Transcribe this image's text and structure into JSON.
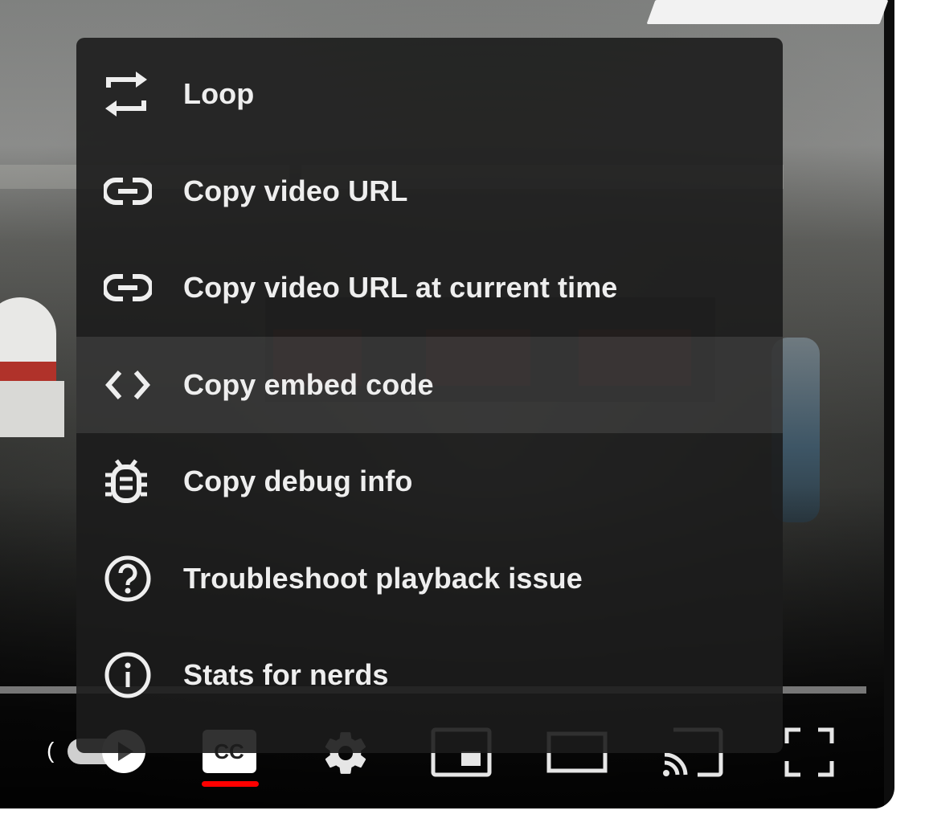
{
  "player": {
    "time_partial": "(",
    "controls": {
      "play": "play-icon",
      "subtitles": "subtitles-icon",
      "settings": "gear-icon",
      "miniplayer": "miniplayer-icon",
      "theater": "theater-mode-icon",
      "cast": "cast-icon",
      "fullscreen": "fullscreen-icon"
    },
    "cc_active_color": "#ff0000"
  },
  "context_menu": {
    "items": [
      {
        "label": "Loop",
        "icon": "loop-icon"
      },
      {
        "label": "Copy video URL",
        "icon": "link-icon"
      },
      {
        "label": "Copy video URL at current time",
        "icon": "link-icon"
      },
      {
        "label": "Copy embed code",
        "icon": "code-icon"
      },
      {
        "label": "Copy debug info",
        "icon": "bug-icon"
      },
      {
        "label": "Troubleshoot playback issue",
        "icon": "help-icon"
      },
      {
        "label": "Stats for nerds",
        "icon": "info-icon"
      }
    ],
    "highlighted_index": 3
  }
}
